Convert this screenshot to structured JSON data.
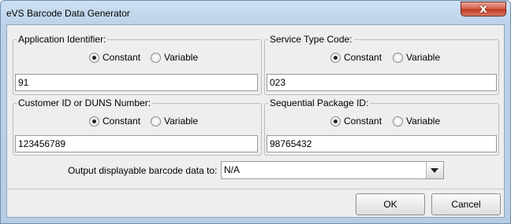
{
  "window": {
    "title": "eVS Barcode Data Generator",
    "close_label": "x"
  },
  "panels": {
    "application_identifier": {
      "legend": "Application Identifier:",
      "options": [
        "Constant",
        "Variable"
      ],
      "selected": "Constant",
      "value": "91"
    },
    "service_type_code": {
      "legend": "Service Type Code:",
      "options": [
        "Constant",
        "Variable"
      ],
      "selected": "Constant",
      "value": "023"
    },
    "customer_id": {
      "legend": "Customer ID or DUNS Number:",
      "options": [
        "Constant",
        "Variable"
      ],
      "selected": "Constant",
      "value": "123456789"
    },
    "sequential_package_id": {
      "legend": "Sequential Package ID:",
      "options": [
        "Constant",
        "Variable"
      ],
      "selected": "Constant",
      "value": "98765432"
    }
  },
  "output": {
    "label": "Output displayable barcode data to:",
    "selected": "N/A"
  },
  "buttons": {
    "ok": "OK",
    "cancel": "Cancel"
  }
}
